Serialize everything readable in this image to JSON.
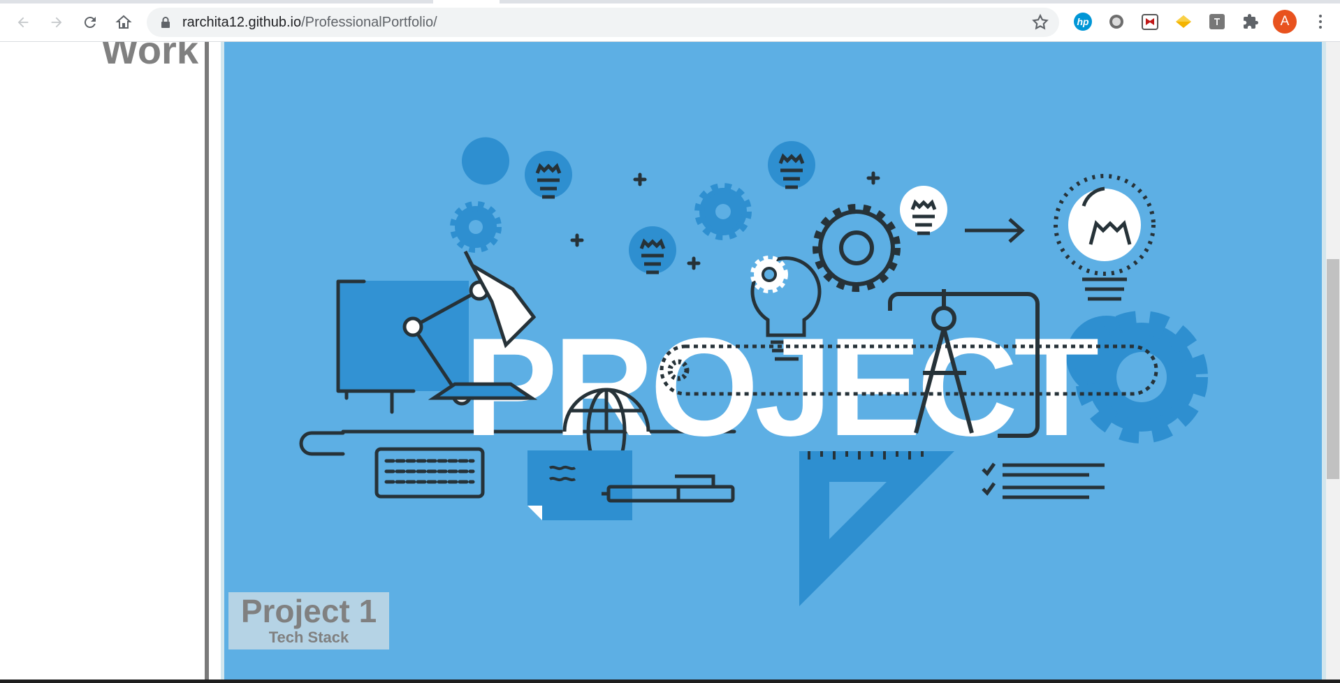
{
  "browser": {
    "url_host": "rarchita12.github.io",
    "url_path": "/ProfessionalPortfolio/",
    "avatar_letter": "A",
    "extensions": [
      "hp-icon",
      "circle-extension-icon",
      "mcafee-icon",
      "diamond-extension-icon",
      "box-extension-icon",
      "puzzle-icon"
    ]
  },
  "page": {
    "section_heading": "Work",
    "project": {
      "title": "Project 1",
      "subtitle": "Tech Stack",
      "image_word": "PROJECT"
    }
  },
  "colors": {
    "panel_bg": "#5dafe4",
    "icon_dark": "#263238",
    "accent_blue": "#2e8fd0",
    "heading_grey": "#808080",
    "avatar": "#e8521e"
  }
}
